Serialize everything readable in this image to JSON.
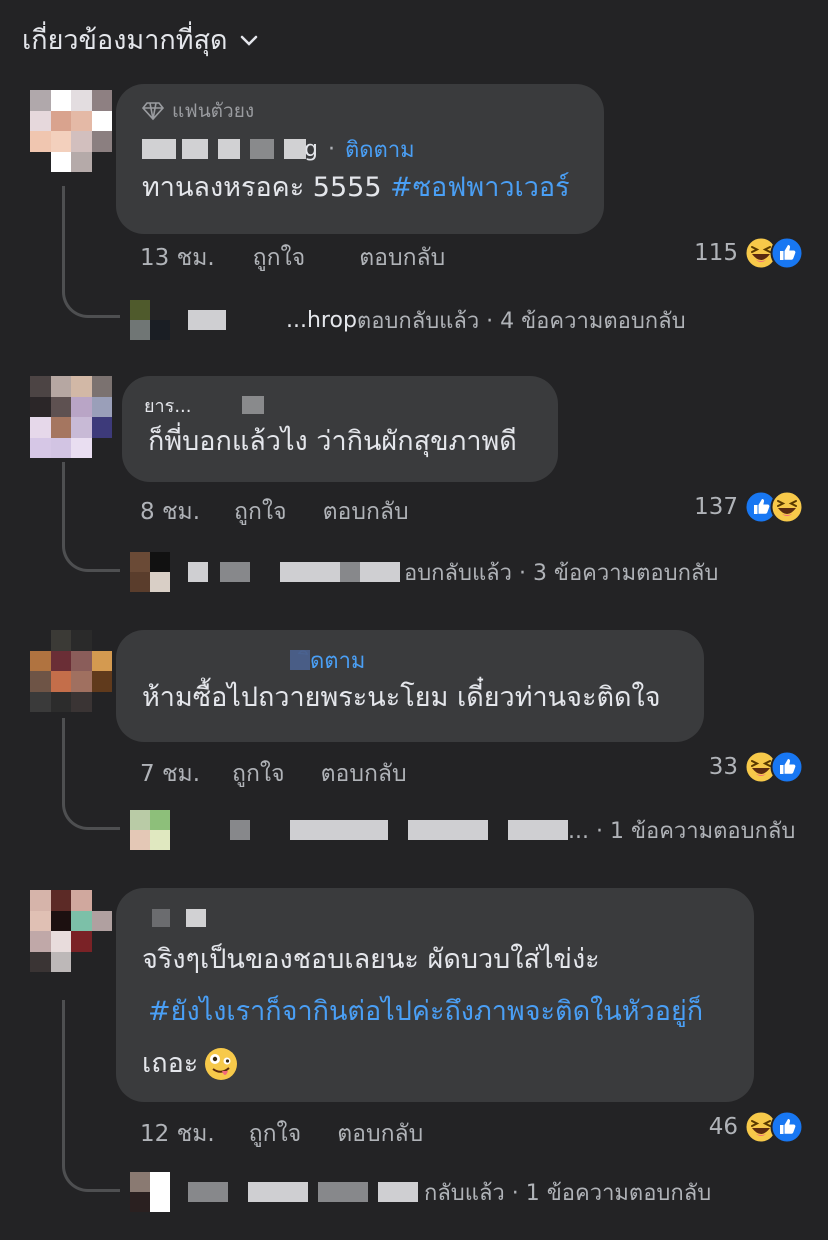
{
  "header": {
    "sort_label": "เกี่ยวข้องมากที่สุด"
  },
  "comments": [
    {
      "badge": "แฟนตัวยง",
      "name_suffix": "g",
      "follow": "ติดตาม",
      "text_plain": "ทานลงหรอคะ 5555 ",
      "text_tag": "#ซอฟพาวเวอร์",
      "time": "13 ชม.",
      "like": "ถูกใจ",
      "reply": "ตอบกลับ",
      "count": "115",
      "reactions": [
        "haha-icon",
        "like-icon"
      ],
      "reply_prefix": "...hrop",
      "reply_text": " ตอบกลับแล้ว · 4 ข้อความตอบกลับ"
    },
    {
      "name_partial": "ยาร...",
      "text_plain": "ก็พี่บอกแล้วไง ว่ากินผักสุขภาพดี",
      "time": "8 ชม.",
      "like": "ถูกใจ",
      "reply": "ตอบกลับ",
      "count": "137",
      "reactions": [
        "like-icon",
        "haha-icon"
      ],
      "reply_text": "อบกลับแล้ว · 3 ข้อความตอบกลับ"
    },
    {
      "follow_partial": "ิดตาม",
      "text_plain": "ห้ามซื้อไปถวายพระนะโยม เดี๋ยวท่านจะติดใจ",
      "time": "7 ชม.",
      "like": "ถูกใจ",
      "reply": "ตอบกลับ",
      "count": "33",
      "reactions": [
        "haha-icon",
        "like-icon"
      ],
      "reply_text": "... · 1 ข้อความตอบกลับ"
    },
    {
      "text_plain": "จริงๆเป็นของชอบเลยนะ ผัดบวบใส่ไข่ง่ะ",
      "text_tag": "#ยังไงเราก็จากินต่อไปค่ะถึงภาพจะติดในหัวอยู่ก็",
      "text_tail": "เถอะ",
      "emoji": "zany-face-icon",
      "time": "12 ชม.",
      "like": "ถูกใจ",
      "reply": "ตอบกลับ",
      "count": "46",
      "reactions": [
        "haha-icon",
        "like-icon"
      ],
      "reply_text": "กลับแล้ว · 1 ข้อความตอบกลับ"
    }
  ],
  "colors": {
    "background": "#232325",
    "bubble": "#3a3b3d",
    "link": "#4a9ff5",
    "secondary": "#b0b3b8"
  }
}
